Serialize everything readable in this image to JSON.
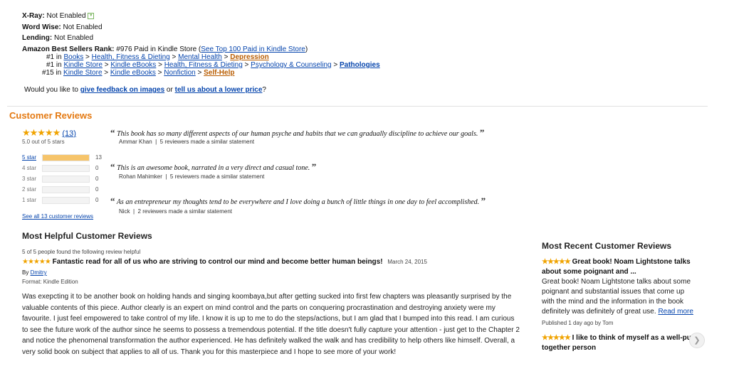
{
  "details": {
    "xray_label": "X-Ray:",
    "xray_value": "Not Enabled",
    "wordwise_label": "Word Wise:",
    "wordwise_value": "Not Enabled",
    "lending_label": "Lending:",
    "lending_value": "Not Enabled",
    "rank_label": "Amazon Best Sellers Rank:",
    "rank_value": "#976 Paid in Kindle Store (",
    "rank_link": "See Top 100 Paid in Kindle Store",
    "rank_close": ")",
    "rank_lines": [
      {
        "pos": "#1 in",
        "c1": "Books",
        "c2": "Health, Fitness & Dieting",
        "c3": "Mental Health",
        "c4": "Depression"
      },
      {
        "pos": "#1 in",
        "c1": "Kindle Store",
        "c2": "Kindle eBooks",
        "c3": "Health, Fitness & Dieting",
        "c4": "Psychology & Counseling",
        "c5": "Pathologies"
      },
      {
        "pos": "#15 in",
        "c1": "Kindle Store",
        "c2": "Kindle eBooks",
        "c3": "Nonfiction",
        "c4": "Self-Help"
      }
    ],
    "feedback_pre": "Would you like to",
    "feedback_link1": "give feedback on images",
    "feedback_mid": "or",
    "feedback_link2": "tell us about a lower price",
    "feedback_end": "?"
  },
  "customer_reviews": {
    "title": "Customer Reviews",
    "overall_count": "(13)",
    "overall_text": "5.0 out of 5 stars",
    "histogram": [
      {
        "label": "5 star",
        "count": "13",
        "fraction": 1.0
      },
      {
        "label": "4 star",
        "count": "0",
        "fraction": 0
      },
      {
        "label": "3 star",
        "count": "0",
        "fraction": 0
      },
      {
        "label": "2 star",
        "count": "0",
        "fraction": 0
      },
      {
        "label": "1 star",
        "count": "0",
        "fraction": 0
      }
    ],
    "see_all": "See all 13 customer reviews",
    "quotes": [
      {
        "text": "This book has so many different aspects of our human psyche and habits that we can gradually discipline to achieve our goals.",
        "author": "Ammar Khan",
        "similar": "5 reviewers made a similar statement"
      },
      {
        "text": "This is an awesome book, narrated in a very direct and casual tone.",
        "author": "Rohan Mahimker",
        "similar": "5 reviewers made a similar statement"
      },
      {
        "text": "As an entrepreneur my thoughts tend to be everywhere and I love doing a bunch of little things in one day to feel accomplished.",
        "author": "Nick",
        "similar": "2 reviewers made a similar statement"
      }
    ]
  },
  "most_helpful": {
    "title": "Most Helpful Customer Reviews",
    "helpful_count": "5 of 5 people found the following review helpful",
    "review_title": "Fantastic read for all of us who are striving to control our mind and become better human beings!",
    "review_date": "March 24, 2015",
    "by_label": "By",
    "author": "Dmitry",
    "format": "Format: Kindle Edition",
    "body": "Was exepcting it to be another book on holding hands and singing koombaya,but after getting sucked into first few chapters was pleasantly surprised by the valuable contents of this piece. Author clearly is an expert on mind control and the parts on conquering procrastination and destroying anxiety were my favourite. I just feel empowered to take control of my life. I know it is up to me to do the steps/actions, but I am glad that I bumped into this read. I am curious to see the future work of the author since he seems to possess a tremendous potential. If the title doesn't fully capture your attention - just get to the Chapter 2 and notice the phenomenal transformation the author experienced. He has definitely walked the walk and has credibility to help others like himself. Overall, a very solid book on subject that applies to all of us. Thank you for this masterpiece and I hope to see more of your work!"
  },
  "most_recent": {
    "title": "Most Recent Customer Reviews",
    "items": [
      {
        "title": "Great book! Noam Lightstone talks about some poignant and ...",
        "body": "Great book! Noam Lightstone talks about some poignant and substantial issues that come up with the mind and the information in the book definitely was definitely of great use.",
        "read_more": "Read more",
        "published": "Published 1 day ago by Tom"
      },
      {
        "title": "I like to think of myself as a well-put together person"
      }
    ]
  },
  "icons": {
    "star": "★★★★★",
    "rating_stars": 5,
    "quote_open": "“",
    "quote_close": "”",
    "next": "❯"
  },
  "colors": {
    "link": "#0645ad",
    "section_title": "#e47911",
    "star": "#f0a300",
    "histogram_fill": "#f6c46a"
  }
}
